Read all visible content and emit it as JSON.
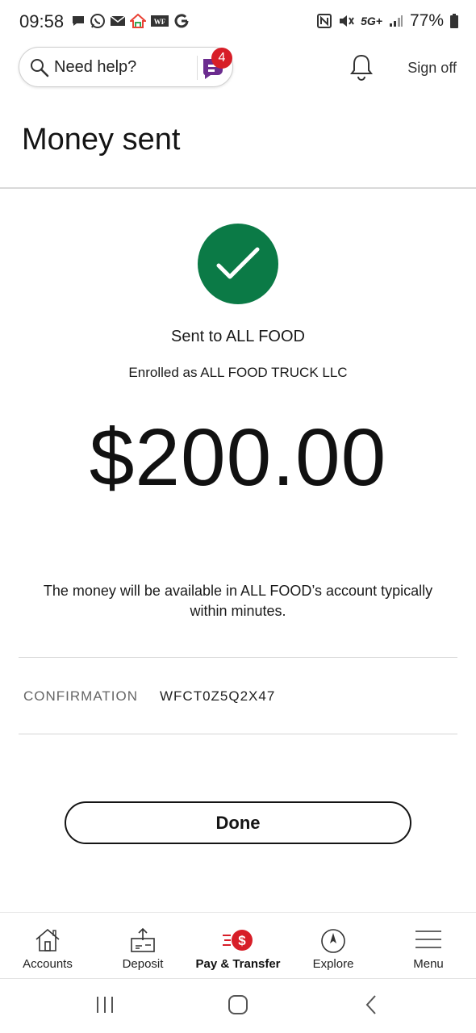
{
  "status_bar": {
    "time": "09:58",
    "network": "5G+",
    "battery": "77%",
    "left_icons": [
      "chat-bubble-icon",
      "whatsapp-icon",
      "mail-icon",
      "google-home-icon",
      "wf-icon",
      "google-icon"
    ],
    "right_icons": [
      "nfc-icon",
      "mute-icon",
      "signal-icon",
      "battery-icon"
    ]
  },
  "header": {
    "search_label": "Need help?",
    "notification_badge": "4",
    "sign_off_label": "Sign off"
  },
  "page": {
    "title": "Money sent"
  },
  "confirmation": {
    "sent_to": "Sent to ALL FOOD",
    "enrolled_as": "Enrolled as ALL FOOD TRUCK LLC",
    "amount": "$200.00",
    "availability_note": "The money will be available in ALL FOOD’s account typically within minutes.",
    "confirmation_label": "CONFIRMATION",
    "confirmation_number": "WFCT0Z5Q2X47",
    "done_label": "Done"
  },
  "bottom_nav": {
    "items": [
      {
        "label": "Accounts",
        "icon": "home-icon"
      },
      {
        "label": "Deposit",
        "icon": "deposit-icon"
      },
      {
        "label": "Pay & Transfer",
        "icon": "pay-transfer-icon",
        "active": true
      },
      {
        "label": "Explore",
        "icon": "compass-icon"
      },
      {
        "label": "Menu",
        "icon": "menu-icon"
      }
    ]
  },
  "colors": {
    "success_green": "#0b7a46",
    "brand_red": "#d71e28",
    "fargo_purple": "#6b2c8f"
  }
}
